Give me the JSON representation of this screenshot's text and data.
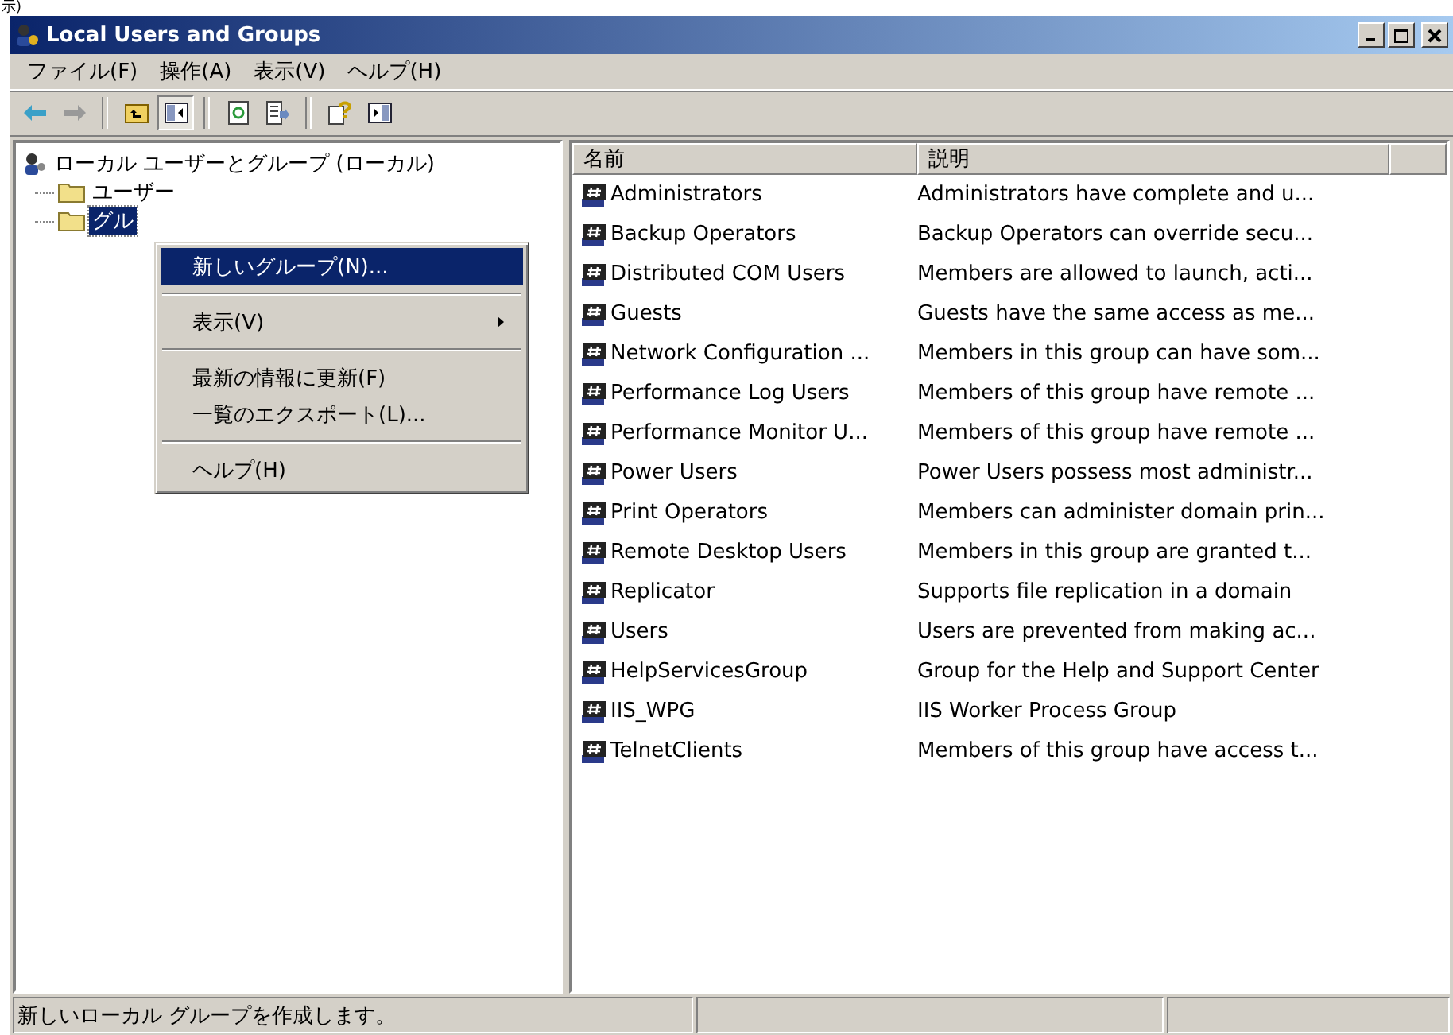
{
  "stray_text": "示)",
  "window": {
    "title": "Local Users and Groups"
  },
  "menu_bar": [
    "ファイル(F)",
    "操作(A)",
    "表示(V)",
    "ヘルプ(H)"
  ],
  "toolbar": [
    {
      "kind": "back",
      "pressed": false,
      "disabled": false
    },
    {
      "kind": "forward",
      "pressed": false,
      "disabled": true
    },
    {
      "kind": "separator"
    },
    {
      "kind": "up",
      "pressed": false
    },
    {
      "kind": "tree",
      "pressed": true
    },
    {
      "kind": "separator"
    },
    {
      "kind": "refresh",
      "pressed": false
    },
    {
      "kind": "export",
      "pressed": false
    },
    {
      "kind": "separator"
    },
    {
      "kind": "help",
      "pressed": false
    },
    {
      "kind": "pane",
      "pressed": false
    }
  ],
  "tree": {
    "label": "ローカル ユーザーとグループ (ローカル)",
    "selected": false,
    "children": [
      {
        "label": "ユーザー",
        "selected": false
      },
      {
        "label": "グル",
        "selected": true
      }
    ]
  },
  "context_menu": [
    {
      "kind": "item",
      "label": "新しいグループ(N)...",
      "selected": true,
      "submenu": false
    },
    {
      "kind": "separator"
    },
    {
      "kind": "item",
      "label": "表示(V)",
      "selected": false,
      "submenu": true
    },
    {
      "kind": "separator"
    },
    {
      "kind": "item",
      "label": "最新の情報に更新(F)",
      "selected": false,
      "submenu": false
    },
    {
      "kind": "item",
      "label": "一覧のエクスポート(L)...",
      "selected": false,
      "submenu": false
    },
    {
      "kind": "separator"
    },
    {
      "kind": "item",
      "label": "ヘルプ(H)",
      "selected": false,
      "submenu": false
    }
  ],
  "list": {
    "columns": [
      "名前",
      "説明"
    ],
    "rows": [
      {
        "name": "Administrators",
        "description": "Administrators have complete and u..."
      },
      {
        "name": "Backup Operators",
        "description": "Backup Operators can override secu..."
      },
      {
        "name": "Distributed COM Users",
        "description": "Members are allowed to launch, acti..."
      },
      {
        "name": "Guests",
        "description": "Guests have the same access as me..."
      },
      {
        "name": "Network Configuration ...",
        "description": "Members in this group can have som..."
      },
      {
        "name": "Performance Log Users",
        "description": "Members of this group have remote ..."
      },
      {
        "name": "Performance Monitor U...",
        "description": "Members of this group have remote ..."
      },
      {
        "name": "Power Users",
        "description": "Power Users possess most administr..."
      },
      {
        "name": "Print Operators",
        "description": "Members can administer domain prin..."
      },
      {
        "name": "Remote Desktop Users",
        "description": "Members in this group are granted t..."
      },
      {
        "name": "Replicator",
        "description": "Supports file replication in a domain"
      },
      {
        "name": "Users",
        "description": "Users are prevented from making ac..."
      },
      {
        "name": "HelpServicesGroup",
        "description": "Group for the Help and Support Center"
      },
      {
        "name": "IIS_WPG",
        "description": "IIS Worker Process Group"
      },
      {
        "name": "TelnetClients",
        "description": "Members of this group have access t..."
      }
    ]
  },
  "status_bar": [
    "新しいローカル グループを作成します。"
  ]
}
